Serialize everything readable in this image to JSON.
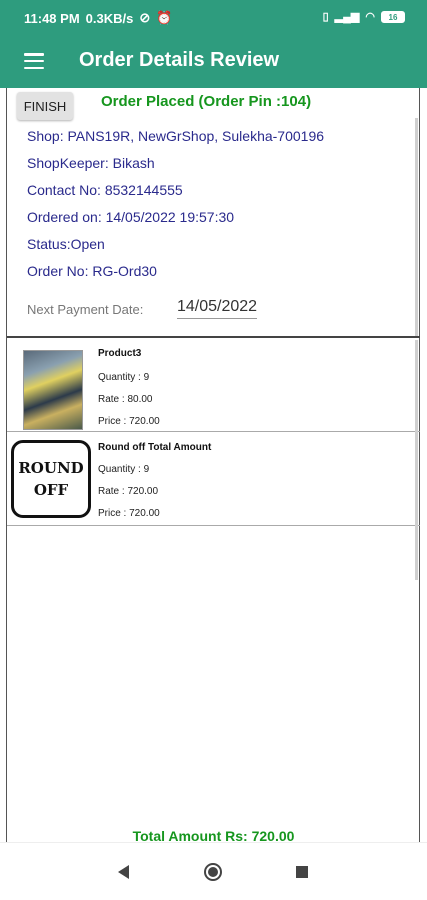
{
  "status_bar": {
    "time": "11:48 PM",
    "speed": "0.3KB/s",
    "battery": "16"
  },
  "app_bar": {
    "title": "Order Details Review",
    "menu_icon": "hamburger-menu-icon"
  },
  "order": {
    "finish_label": "FINISH",
    "placed_text": "Order Placed (Order Pin :104)",
    "shop": "Shop: PANS19R, NewGrShop, Sulekha-700196",
    "shopkeeper": "ShopKeeper: Bikash",
    "contact": "Contact No: 8532144555",
    "ordered_on": "Ordered on: 14/05/2022 19:57:30",
    "status": "Status:Open",
    "order_no": "Order No: RG-Ord30",
    "next_payment_label": "Next Payment Date:",
    "next_payment_value": "14/05/2022"
  },
  "items": [
    {
      "name": "Product3",
      "quantity": "Quantity : 9",
      "rate": "Rate : 80.00",
      "price": "Price : 720.00"
    },
    {
      "name": "Round off Total Amount",
      "image_line1": "ROUND",
      "image_line2": "OFF",
      "quantity": "Quantity : 9",
      "rate": "Rate : 720.00",
      "price": "Price : 720.00"
    }
  ],
  "total": "Total Amount Rs: 720.00",
  "colors": {
    "primary": "#2e9c7e",
    "green_text": "#16961e",
    "info_text": "#2a2a8c"
  }
}
